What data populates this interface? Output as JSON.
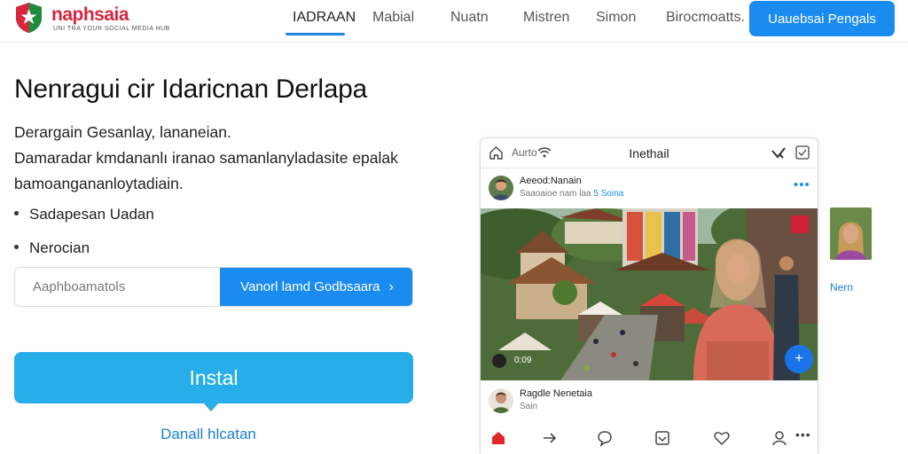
{
  "header": {
    "logo_name": "naphsaia",
    "logo_tagline": "UNI TRA YOUR SOCIAL MEDIA HUB",
    "nav": [
      "IADRAAN",
      "Mabial",
      "Nuatn",
      "Mistren",
      "Simon",
      "Birocmoatts."
    ],
    "active_nav_index": 0,
    "cta_label": "Uauebsai Pengals"
  },
  "hero": {
    "title": "Nenragui cir Idaricnan Derlapa",
    "paragraph_lines": [
      "Derargain Gesanlay, lananeian.",
      "Damaradar kmdananlı iranao samanlanyladasite epalak",
      "bamoangananloytadiain."
    ],
    "bullets": [
      "Sadapesan Uadan",
      "Nerocian"
    ],
    "input_placeholder": "Aaphboamatols",
    "input_button_label": "Vanorl lamd Godbsaara",
    "install_label": "Instal",
    "link_label": "Danall hlcatan"
  },
  "phone": {
    "status_text": "Aurto",
    "title": "Inethail",
    "post_author": "Aeeod:Nanain",
    "post_meta": "Saaoaioe nam laa",
    "post_meta_count": "5",
    "post_meta_link": "Soina",
    "video_time": "0:09",
    "comment_author": "Ragdle Nenetaia",
    "comment_meta": "Sain"
  },
  "side": {
    "label": "Nern"
  },
  "colors": {
    "accent": "#1a8cf0",
    "install": "#27aee8",
    "brand_red": "#d7263d",
    "link": "#1a7fd4"
  },
  "icons": [
    "shield-logo-icon",
    "home-icon",
    "wifi-icon",
    "heart-icon",
    "check-square-icon",
    "more-icon",
    "play-icon",
    "plus-icon",
    "arrow-right-icon",
    "home-tab-icon",
    "share-icon",
    "comment-icon",
    "inbox-icon",
    "like-icon",
    "profile-icon"
  ]
}
